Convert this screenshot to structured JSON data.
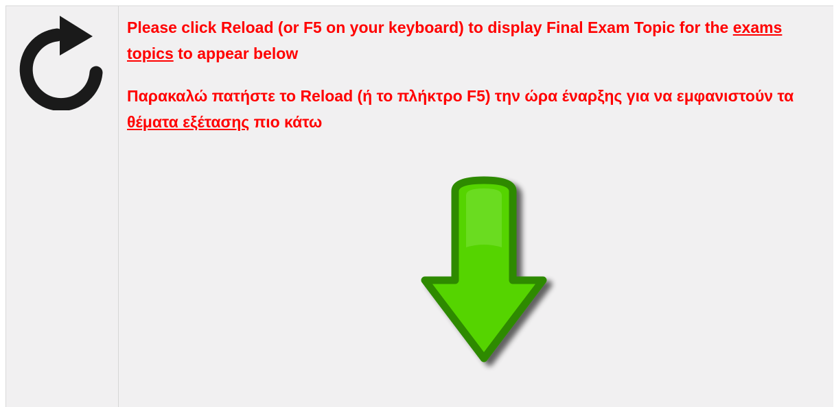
{
  "reload": {
    "icon": "reload-icon"
  },
  "notice_en": {
    "before": "Please click Reload (or F5 on your keyboard) to display Final Exam Topic for the ",
    "link": "exams topics",
    "after": " to appear below"
  },
  "notice_el": {
    "before": "Παρακαλώ πατήστε το Reload (ή το πλήκτρο F5) την ώρα έναρξης για να εμφανιστούν τα ",
    "link": "θέματα εξέτασης",
    "after": " πιο κάτω"
  },
  "arrow": {
    "icon": "down-arrow-icon",
    "fill_color": "#55d400",
    "stroke_color": "#2e8a00"
  },
  "colors": {
    "text": "#ff0000",
    "background": "#f1f0f1",
    "icon": "#1a1a1a"
  }
}
